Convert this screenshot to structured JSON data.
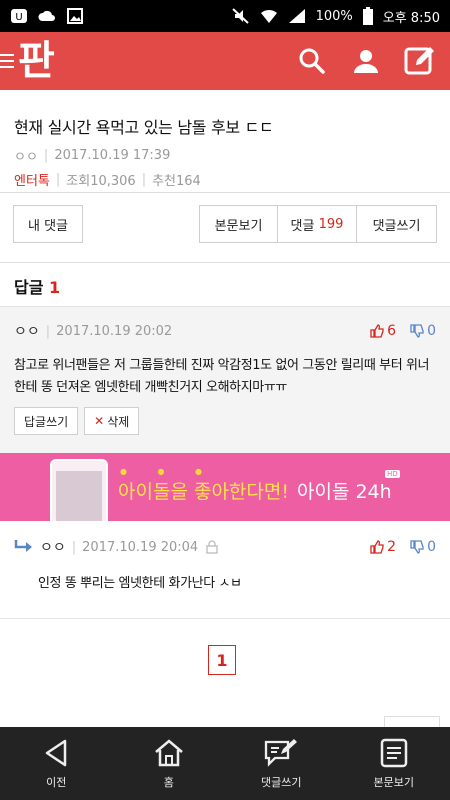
{
  "statusbar": {
    "battery": "100%",
    "time": "오후 8:50"
  },
  "appbar": {
    "logo": "판"
  },
  "post": {
    "title": "현재 실시간 욕먹고 있는 남돌 후보 ㄷㄷ",
    "author": "ㅇㅇ",
    "date": "2017.10.19 17:39",
    "category": "엔터톡",
    "views": "조회10,306",
    "recommends": "추천164"
  },
  "buttons": {
    "my_comments": "내 댓글",
    "view_post": "본문보기",
    "comments_label": "댓글",
    "comments_count": "199",
    "write_comment": "댓글쓰기"
  },
  "replies": {
    "label": "답글",
    "count": "1"
  },
  "comment1": {
    "author": "ㅇㅇ",
    "date": "2017.10.19 20:02",
    "up": "6",
    "down": "0",
    "body": "참고로 위너팬들은 저 그룹들한테 진짜 악감정1도 없어 그동안 릴리때 부터 위너한테 똥 던져온 엠넷한테 개빡친거지 오해하지마ㅠㅠ",
    "reply_button": "답글쓰기",
    "delete_button": "삭제"
  },
  "banner": {
    "copy": "아이돌을 좋아한다면!",
    "brand": "아이돌 24h",
    "badge": "HD"
  },
  "comment2": {
    "author": "ㅇㅇ",
    "date": "2017.10.19 20:04",
    "up": "2",
    "down": "0",
    "body": "인정 똥 뿌리는 엠넷한테 화가난다 ㅅㅂ"
  },
  "pagination": {
    "current": "1"
  },
  "bottomnav": {
    "back": "이전",
    "home": "홈",
    "write": "댓글쓰기",
    "view": "본문보기"
  },
  "colors": {
    "brand": "#e24a48",
    "accent": "#d7251c",
    "banner": "#ee5ea2"
  }
}
